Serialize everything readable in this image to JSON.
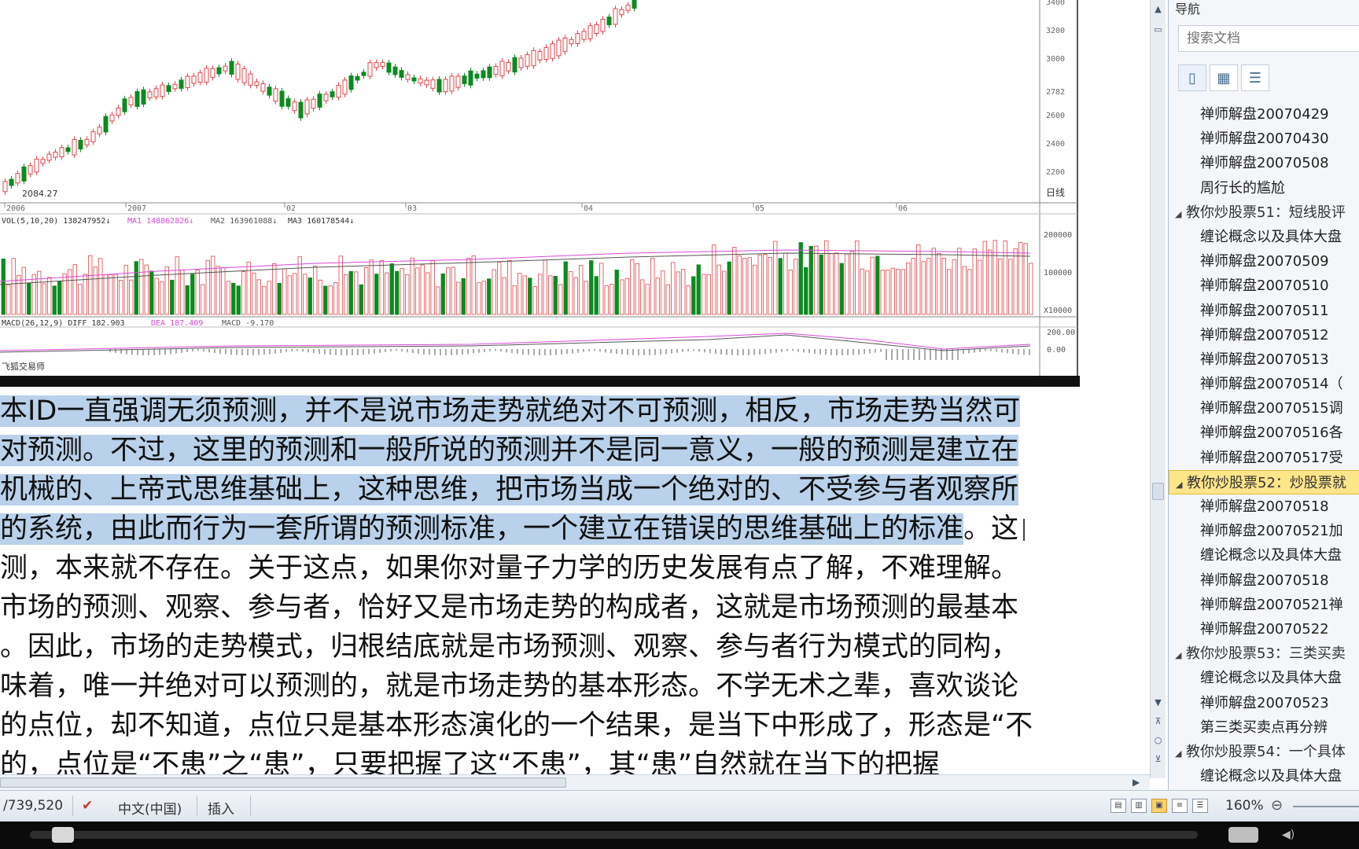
{
  "doc": {
    "chart": {
      "low_label": "2084.27",
      "peak_label": "2782",
      "price_ticks": [
        "3400",
        "3200",
        "3000",
        "2782",
        "2600",
        "2400",
        "2200"
      ],
      "date_ticks": [
        "2006",
        "2007",
        "02",
        "03",
        "04",
        "05",
        "06"
      ],
      "period_label": "日线",
      "vol_legend": {
        "vol": "VOL(5,10,20) 138247952↓",
        "ma1": "MA1 148862826↓",
        "ma2": "MA2 163961088↓",
        "ma3": "MA3 160178544↓"
      },
      "vol_ticks": [
        "200000",
        "100000",
        "X10000"
      ],
      "macd_legend": {
        "macd": "MACD(26,12,9) DIFF 182.903",
        "dea": "DEA 187.409",
        "macd_val": "MACD -9.170"
      },
      "macd_ticks": [
        "200.00",
        "0.00"
      ],
      "footer": "飞狐交易师",
      "colors": {
        "up": "#e0474c",
        "down": "#0c8a20",
        "ma1": "#d94ad8",
        "ma2": "#555555"
      }
    },
    "paragraph_lines": [
      {
        "hl": "本ID一直强调无须预测，并不是说市场走势就绝对不可预测，相反，市场走势当然可",
        "rest": ""
      },
      {
        "hl": "对预测。不过，这里的预测和一般所说的预测并不是同一意义，一般的预测是建立在",
        "rest": ""
      },
      {
        "hl": "机械的、上帝式思维基础上，这种思维，把市场当成一个绝对的、不受参与者观察所",
        "rest": ""
      },
      {
        "hl": "的系统，由此而行为一套所谓的预测标准，一个建立在错误的思维基础上的标准",
        "rest": "。这"
      },
      {
        "hl": "",
        "rest": "测，本来就不存在。关于这点，如果你对量子力学的历史发展有点了解，不难理解。"
      },
      {
        "hl": "",
        "rest": "市场的预测、观察、参与者，恰好又是市场走势的构成者，这就是市场预测的最基本"
      },
      {
        "hl": "",
        "rest": "。因此，市场的走势模式，归根结底就是市场预测、观察、参与者行为模式的同构，"
      },
      {
        "hl": "",
        "rest": "味着，唯一并绝对可以预测的，就是市场走势的基本形态。不学无术之辈，喜欢谈论"
      },
      {
        "hl": "",
        "rest": "的点位，却不知道，点位只是基本形态演化的一个结果，是当下中形成了，形态是“不"
      },
      {
        "hl": "",
        "rest": "的，点位是“不患”之“患”，只要把握了这“不患”，其“患”自然就在当下的把握"
      }
    ]
  },
  "nav": {
    "title": "导航",
    "search_placeholder": "搜索文档",
    "tabs": [
      "headings-view",
      "pages-view",
      "results-view"
    ],
    "items": [
      {
        "level": 1,
        "label": "禅师解盘20070429"
      },
      {
        "level": 1,
        "label": "禅师解盘20070430"
      },
      {
        "level": 1,
        "label": "禅师解盘20070508"
      },
      {
        "level": 1,
        "label": "周行长的尴尬"
      },
      {
        "level": 0,
        "label": "教你炒股票51：短线股评"
      },
      {
        "level": 1,
        "label": "缠论概念以及具体大盘"
      },
      {
        "level": 1,
        "label": "禅师解盘20070509"
      },
      {
        "level": 1,
        "label": "禅师解盘20070510"
      },
      {
        "level": 1,
        "label": "禅师解盘20070511"
      },
      {
        "level": 1,
        "label": "禅师解盘20070512"
      },
      {
        "level": 1,
        "label": "禅师解盘20070513"
      },
      {
        "level": 1,
        "label": "禅师解盘20070514（"
      },
      {
        "level": 1,
        "label": "禅师解盘20070515调"
      },
      {
        "level": 1,
        "label": "禅师解盘20070516各"
      },
      {
        "level": 1,
        "label": "禅师解盘20070517受"
      },
      {
        "level": 0,
        "label": "教你炒股票52：炒股票就",
        "selected": true
      },
      {
        "level": 1,
        "label": "禅师解盘20070518"
      },
      {
        "level": 1,
        "label": "禅师解盘20070521加"
      },
      {
        "level": 1,
        "label": "缠论概念以及具体大盘"
      },
      {
        "level": 1,
        "label": "禅师解盘20070518"
      },
      {
        "level": 1,
        "label": "禅师解盘20070521禅"
      },
      {
        "level": 1,
        "label": "禅师解盘20070522"
      },
      {
        "level": 0,
        "label": "教你炒股票53：三类买卖"
      },
      {
        "level": 1,
        "label": "缠论概念以及具体大盘"
      },
      {
        "level": 1,
        "label": "禅师解盘20070523"
      },
      {
        "level": 1,
        "label": "第三类买卖点再分辨"
      },
      {
        "level": 0,
        "label": "教你炒股票54：一个具体"
      },
      {
        "level": 1,
        "label": "缠论概念以及具体大盘"
      }
    ]
  },
  "status": {
    "words": "/739,520",
    "language": "中文(中国)",
    "mode": "插入",
    "zoom": "160%"
  }
}
